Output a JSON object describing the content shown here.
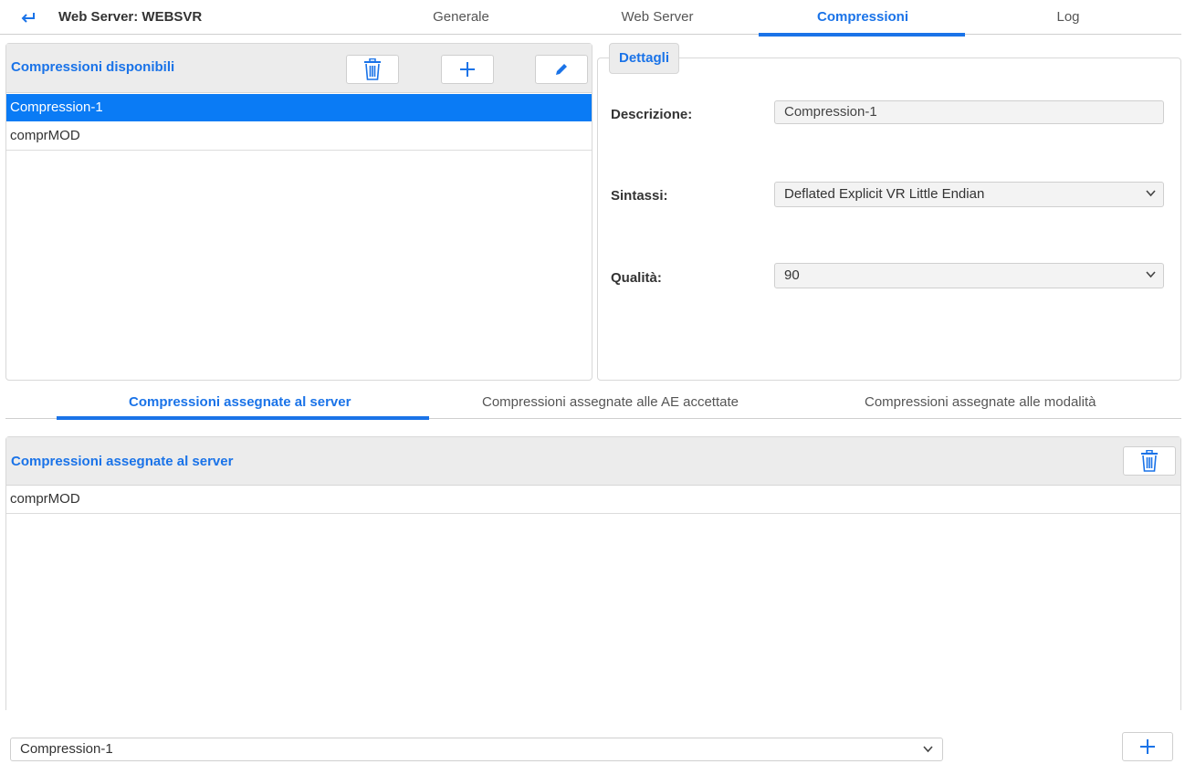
{
  "header": {
    "back_icon": "return-arrow-icon",
    "title": "Web Server: WEBSVR",
    "tabs": [
      {
        "label": "Generale",
        "active": false
      },
      {
        "label": "Web Server",
        "active": false
      },
      {
        "label": "Compressioni",
        "active": true
      },
      {
        "label": "Log",
        "active": false
      }
    ]
  },
  "available": {
    "title": "Compressioni disponibili",
    "buttons": {
      "delete_icon": "trash-icon",
      "add_icon": "plus-icon",
      "edit_icon": "pencil-icon"
    },
    "items": [
      {
        "label": "Compression-1",
        "selected": true
      },
      {
        "label": "comprMOD",
        "selected": false
      }
    ]
  },
  "details": {
    "legend": "Dettagli",
    "description_label": "Descrizione:",
    "description_value": "Compression-1",
    "syntax_label": "Sintassi:",
    "syntax_value": "Deflated Explicit VR Little Endian",
    "quality_label": "Qualità:",
    "quality_value": "90"
  },
  "subtabs": [
    {
      "label": "Compressioni assegnate al server",
      "active": true
    },
    {
      "label": "Compressioni assegnate alle AE accettate",
      "active": false
    },
    {
      "label": "Compressioni assegnate alle modalità",
      "active": false
    }
  ],
  "assigned": {
    "title": "Compressioni assegnate al server",
    "delete_icon": "trash-icon",
    "items": [
      {
        "label": "comprMOD"
      }
    ],
    "select_value": "Compression-1",
    "add_icon": "plus-icon"
  },
  "colors": {
    "accent": "#1a73e8",
    "selected_row": "#0a7bf5",
    "header_bg": "#ececec"
  }
}
